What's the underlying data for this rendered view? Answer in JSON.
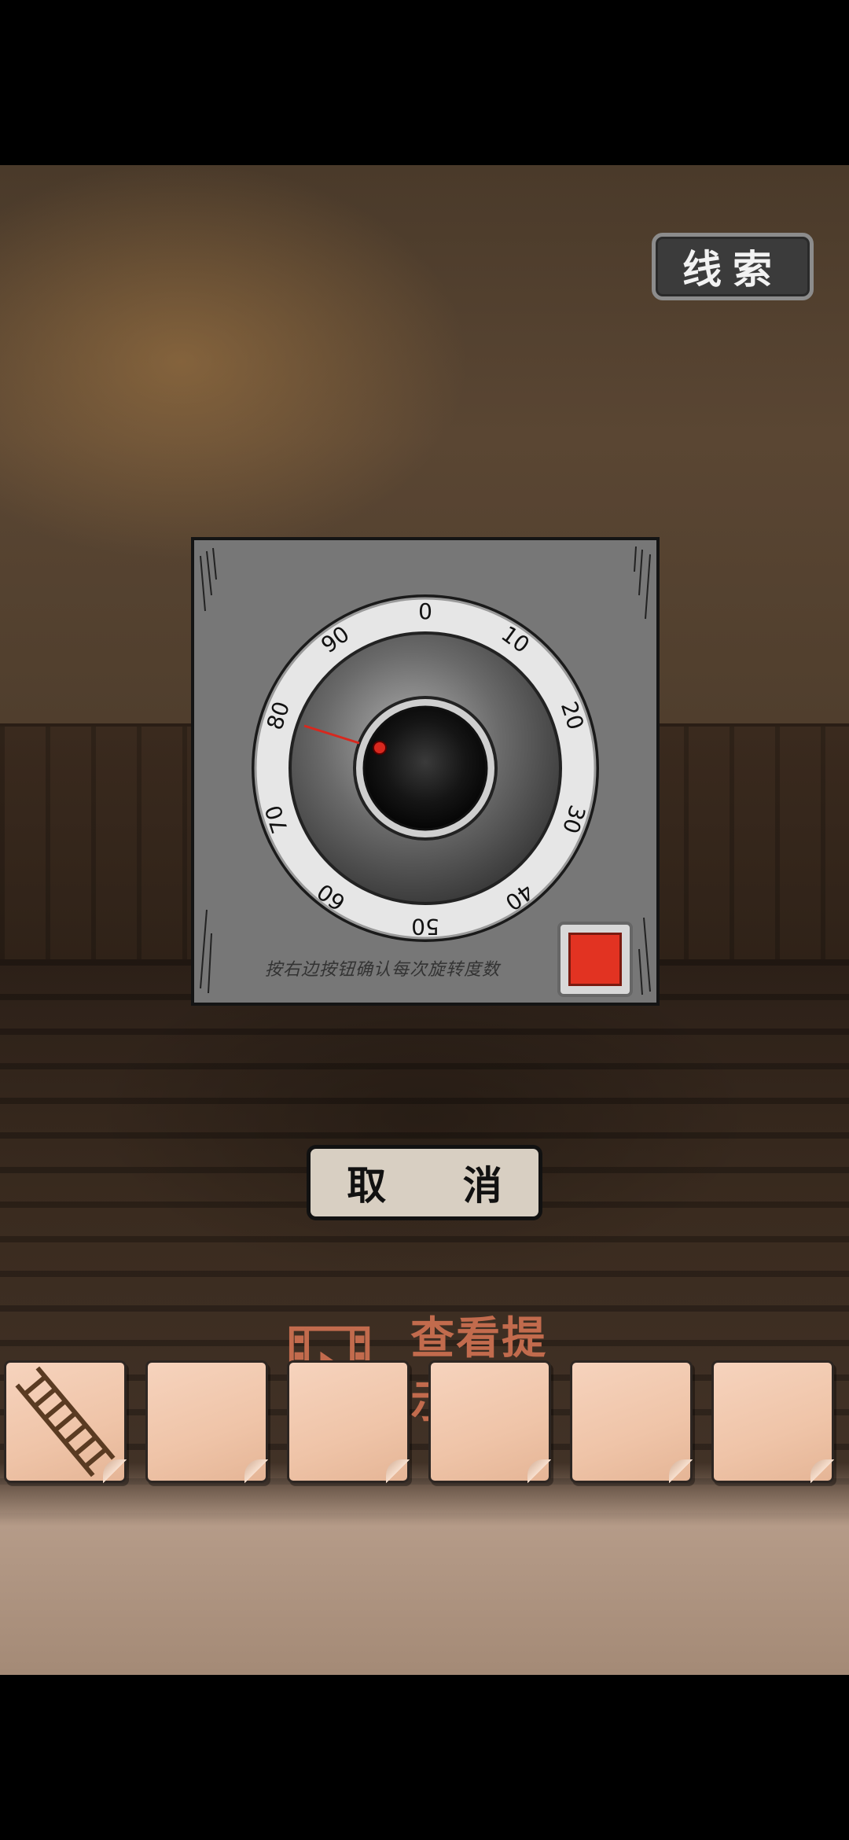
{
  "header": {
    "clue_label": "线索"
  },
  "safe": {
    "dial_numbers": [
      "0",
      "10",
      "20",
      "30",
      "40",
      "50",
      "60",
      "70",
      "80",
      "90"
    ],
    "pointer_value": 79,
    "instruction": "按右边按钮确认每次旋转度数",
    "confirm_color": "#e23322"
  },
  "actions": {
    "cancel_label": "取 消",
    "hint_label": "查看提示"
  },
  "inventory": {
    "slots": [
      {
        "item": "ladder-icon"
      },
      {
        "item": ""
      },
      {
        "item": ""
      },
      {
        "item": ""
      },
      {
        "item": ""
      },
      {
        "item": ""
      }
    ]
  }
}
